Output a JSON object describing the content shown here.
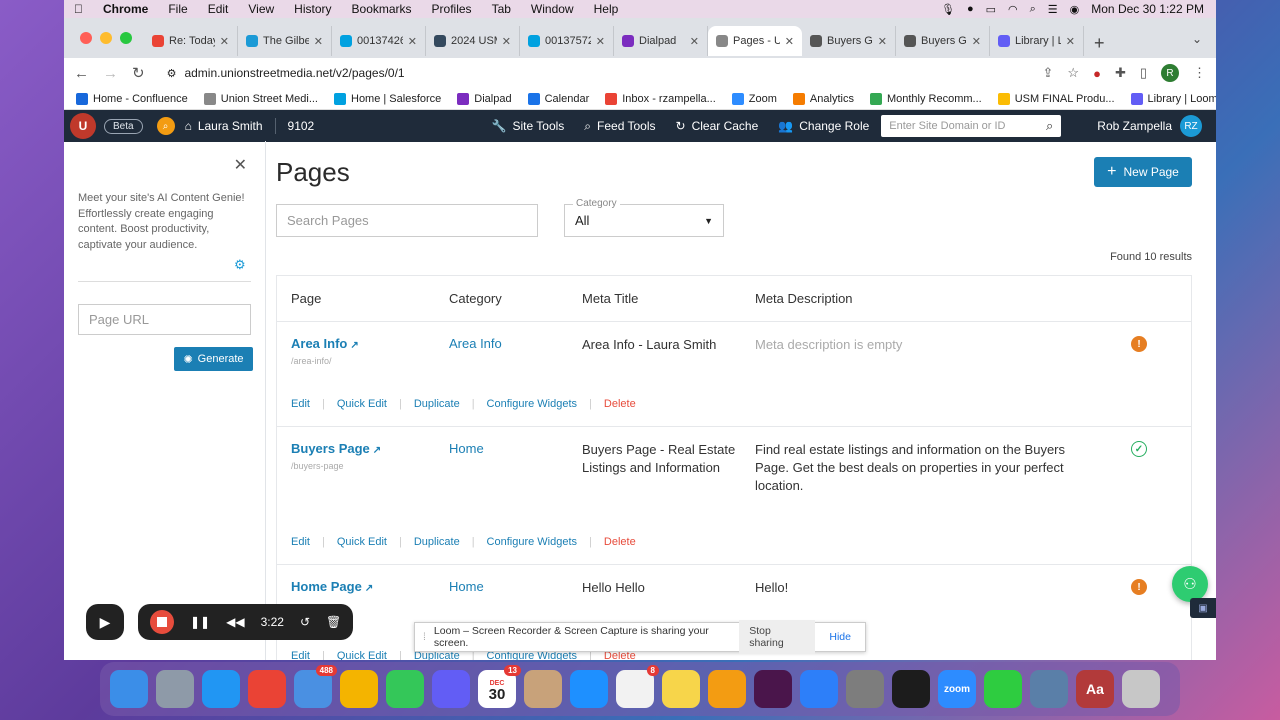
{
  "menubar": {
    "apple": "",
    "app": "Chrome",
    "items": [
      "File",
      "Edit",
      "View",
      "History",
      "Bookmarks",
      "Profiles",
      "Tab",
      "Window",
      "Help"
    ],
    "datetime": "Mon Dec 30  1:22 PM"
  },
  "tabs": [
    {
      "title": "Re: Today",
      "color": "#ea4335"
    },
    {
      "title": "The Gilbe",
      "color": "#1b9ad6"
    },
    {
      "title": "00137426",
      "color": "#00a1e0"
    },
    {
      "title": "2024 USM",
      "color": "#34495e"
    },
    {
      "title": "00137572",
      "color": "#00a1e0"
    },
    {
      "title": "Dialpad",
      "color": "#7b2cbf"
    },
    {
      "title": "Pages - U",
      "color": "#888"
    },
    {
      "title": "Buyers G",
      "color": "#555"
    },
    {
      "title": "Buyers G",
      "color": "#555"
    },
    {
      "title": "Library | L",
      "color": "#625df5"
    }
  ],
  "address": {
    "url": "admin.unionstreetmedia.net/v2/pages/0/1",
    "profile": "R"
  },
  "bookmarks": [
    {
      "label": "Home - Confluence",
      "color": "#1868db"
    },
    {
      "label": "Union Street Medi...",
      "color": "#888"
    },
    {
      "label": "Home | Salesforce",
      "color": "#00a1e0"
    },
    {
      "label": "Dialpad",
      "color": "#7b2cbf"
    },
    {
      "label": "Calendar",
      "color": "#1a73e8"
    },
    {
      "label": "Inbox - rzampella...",
      "color": "#ea4335"
    },
    {
      "label": "Zoom",
      "color": "#2d8cff"
    },
    {
      "label": "Analytics",
      "color": "#f57c00"
    },
    {
      "label": "Monthly Recomm...",
      "color": "#34a853"
    },
    {
      "label": "USM FINAL Produ...",
      "color": "#fbbc04"
    },
    {
      "label": "Library | Loom",
      "color": "#625df5"
    }
  ],
  "apphead": {
    "beta": "Beta",
    "account": "Laura Smith",
    "site_id": "9102",
    "tools": [
      "Site Tools",
      "Feed Tools",
      "Clear Cache",
      "Change Role"
    ],
    "search_placeholder": "Enter Site Domain or ID",
    "user": "Rob Zampella",
    "initials": "RZ"
  },
  "sidebar": {
    "genie_text": "Meet your site's AI Content Genie! Effortlessly create engaging content. Boost productivity, captivate your audience.",
    "page_url_placeholder": "Page URL",
    "generate": "Generate"
  },
  "main": {
    "title": "Pages",
    "new_page": "New Page",
    "search_placeholder": "Search Pages",
    "category_label": "Category",
    "category_value": "All",
    "found": "Found 10 results",
    "columns": [
      "Page",
      "Category",
      "Meta Title",
      "Meta Description"
    ],
    "rows": [
      {
        "name": "Area Info",
        "slug": "/area-info/",
        "category": "Area Info",
        "meta_title": "Area Info - Laura Smith",
        "meta_desc": "Meta description is empty",
        "status": "warning"
      },
      {
        "name": "Buyers Page",
        "slug": "/buyers-page",
        "category": "Home",
        "meta_title": "Buyers Page - Real Estate Listings and Information",
        "meta_desc": "Find real estate listings and information on the Buyers Page. Get the best deals on properties in your perfect location.",
        "status": "ok"
      },
      {
        "name": "Home Page",
        "slug": "",
        "category": "Home",
        "meta_title": "Hello Hello",
        "meta_desc": "Hello!",
        "status": "warning"
      }
    ],
    "actions": [
      "Edit",
      "Quick Edit",
      "Duplicate",
      "Configure Widgets",
      "Delete"
    ]
  },
  "recorder": {
    "time": "3:22"
  },
  "loom": {
    "message": "Loom – Screen Recorder & Screen Capture is sharing your screen.",
    "stop": "Stop sharing",
    "hide": "Hide"
  },
  "dock": [
    {
      "name": "finder",
      "color": "#3b8ee8"
    },
    {
      "name": "launchpad",
      "color": "#8e9aa8"
    },
    {
      "name": "safari",
      "color": "#2196f3"
    },
    {
      "name": "chrome",
      "color": "#ea4335"
    },
    {
      "name": "mail",
      "color": "#4a90e2",
      "badge": "488"
    },
    {
      "name": "photos",
      "color": "#f4b400"
    },
    {
      "name": "facetime",
      "color": "#34c759"
    },
    {
      "name": "loom",
      "color": "#625df5"
    },
    {
      "name": "calendar",
      "color": "#ffffff",
      "label": "30",
      "sub": "DEC",
      "badge": "13"
    },
    {
      "name": "contacts",
      "color": "#c8a27a"
    },
    {
      "name": "app-store",
      "color": "#1e90ff"
    },
    {
      "name": "reminders",
      "color": "#f2f2f2",
      "badge": "8"
    },
    {
      "name": "notes",
      "color": "#f7d54a"
    },
    {
      "name": "pages",
      "color": "#f39c12"
    },
    {
      "name": "slack",
      "color": "#4a154b"
    },
    {
      "name": "keynote",
      "color": "#2d7ff9"
    },
    {
      "name": "system-preferences",
      "color": "#7d7d7d"
    },
    {
      "name": "quicktime",
      "color": "#1c1c1c"
    },
    {
      "name": "zoom",
      "color": "#2d8cff",
      "label": "zoom"
    },
    {
      "name": "numbers",
      "color": "#2ecc40"
    },
    {
      "name": "preview",
      "color": "#5a7fa8"
    },
    {
      "name": "dictionary",
      "color": "#b23a3a",
      "label": "Aa"
    },
    {
      "name": "trash",
      "color": "#c7c7c7"
    }
  ]
}
